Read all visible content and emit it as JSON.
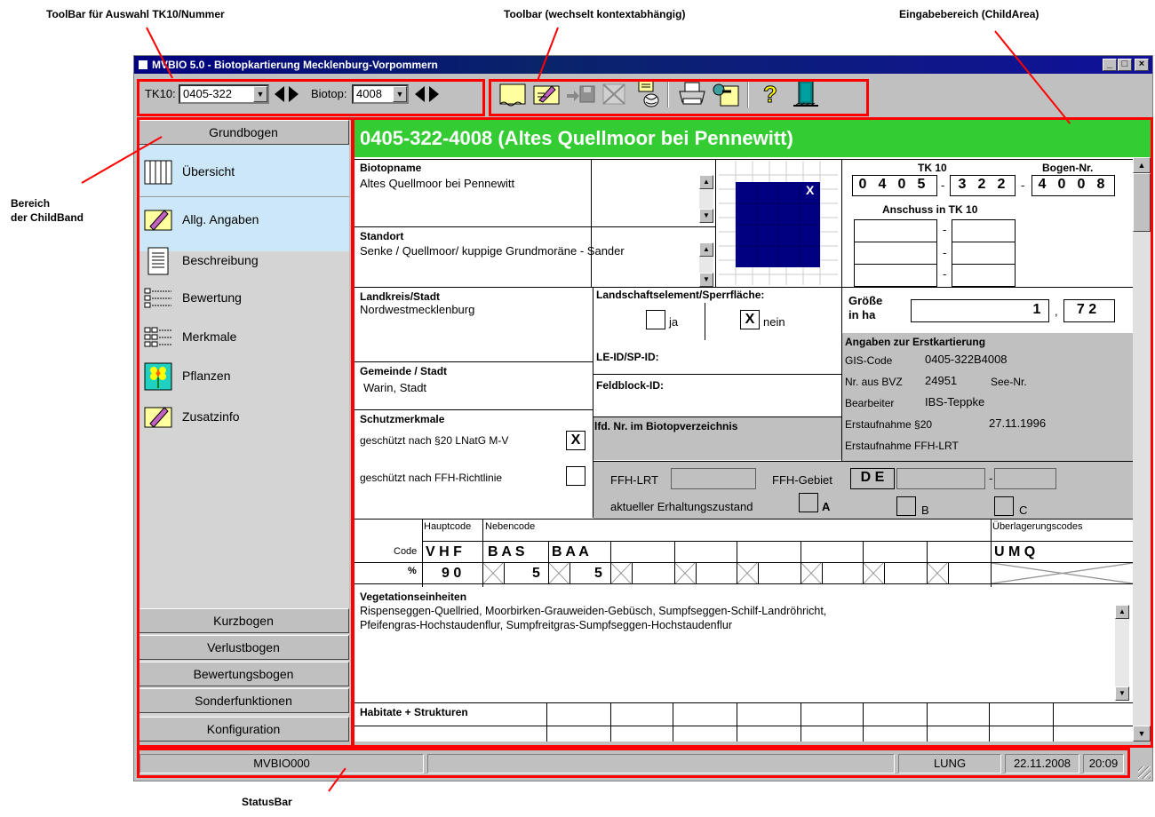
{
  "callouts": {
    "toolbar_tk10": "ToolBar für Auswahl TK10/Nummer",
    "toolbar_context": "Toolbar (wechselt kontextabhängig)",
    "childarea": "Eingabebereich (ChildArea)",
    "childband": "Bereich\nder ChildBand",
    "childband_line1": "Bereich",
    "childband_line2": "der ChildBand",
    "statusbar": "StatusBar"
  },
  "window": {
    "title": "MVBIO 5.0 - Biotopkartierung Mecklenburg-Vorpommern",
    "min": "_",
    "max": "□",
    "close": "×"
  },
  "toolbar": {
    "tk10_label": "TK10:",
    "tk10_value": "0405-322",
    "biotop_label": "Biotop:",
    "biotop_value": "4008",
    "buttons": [
      "new-icon",
      "edit-icon",
      "save-icon",
      "delete-icon",
      "export-icon",
      "print-icon",
      "search-icon",
      "help-icon",
      "exit-icon"
    ]
  },
  "sidebar": {
    "top_button": "Grundbogen",
    "items": [
      {
        "label": "Übersicht",
        "icon": "table-icon"
      },
      {
        "label": "Allg. Angaben",
        "icon": "edit-form-icon"
      },
      {
        "label": "Beschreibung",
        "icon": "notepad-icon"
      },
      {
        "label": "Bewertung",
        "icon": "checklist-icon"
      },
      {
        "label": "Merkmale",
        "icon": "grid-list-icon"
      },
      {
        "label": "Pflanzen",
        "icon": "flower-icon"
      },
      {
        "label": "Zusatzinfo",
        "icon": "edit-form-icon"
      }
    ],
    "bottom_buttons": [
      "Kurzbogen",
      "Verlustbogen",
      "Bewertungsbogen",
      "Sonderfunktionen",
      "Konfiguration"
    ]
  },
  "form": {
    "header": "0405-322-4008 (Altes Quellmoor bei Pennewitt)",
    "biotopname_label": "Biotopname",
    "biotopname_value": "Altes Quellmoor bei Pennewitt",
    "standort_label": "Standort",
    "standort_value": "Senke / Quellmoor/ kuppige Grundmoräne - Sander",
    "tk10_label": "TK 10",
    "tk10_digits": [
      "0",
      "4",
      "0",
      "5",
      "3",
      "2",
      "2"
    ],
    "bogen_label": "Bogen-Nr.",
    "bogen_digits": [
      "4",
      "0",
      "0",
      "8"
    ],
    "dash": "-",
    "anschuss_label": "Anschuss in TK 10",
    "map_mark": "X",
    "landkreis_label": "Landkreis/Stadt",
    "landkreis_value": "Nordwestmecklenburg",
    "landschaft_label": "Landschaftselement/Sperrfläche:",
    "ja_label": "ja",
    "nein_label": "nein",
    "nein_mark": "X",
    "groesse_label_1": "Größe",
    "groesse_label_2": "in ha",
    "groesse_int": "1",
    "groesse_comma": ",",
    "groesse_dec": "7 2",
    "leid_label": "LE-ID/SP-ID:",
    "gemeinde_label": "Gemeinde / Stadt",
    "gemeinde_value": "Warin, Stadt",
    "feldblock_label": "Feldblock-ID:",
    "lfd_label": "lfd. Nr. im Biotopverzeichnis",
    "erst_label": "Angaben zur Erstkartierung",
    "gis_label": "GIS-Code",
    "gis_value": "0405-322B4008",
    "bvz_label": "Nr. aus BVZ",
    "bvz_value": "24951",
    "see_label": "See-Nr.",
    "bearbeiter_label": "Bearbeiter",
    "bearbeiter_value": "IBS-Teppke",
    "erst20_label": "Erstaufnahme §20",
    "erst20_value": "27.11.1996",
    "erstffh_label": "Erstaufnahme FFH-LRT",
    "schutz_label": "Schutzmerkmale",
    "schutz20_label": "geschützt nach §20 LNatG M-V",
    "schutz20_mark": "X",
    "schutzffh_label": "geschützt nach FFH-Richtlinie",
    "ffhlrt_label": "FFH-LRT",
    "ffhgebiet_label": "FFH-Gebiet",
    "ffhgebiet_prefix": "D E",
    "erhaltung_label": "aktueller Erhaltungszustand",
    "erh_a": "A",
    "erh_b": "B",
    "erh_c": "C",
    "hauptcode_label": "Hauptcode",
    "nebencode_label": "Nebencode",
    "ueber_label": "Überlagerungscodes",
    "code_row_label": "Code",
    "pct_row_label": "%",
    "code_hf": "V H F",
    "code_n1": "B A S",
    "code_n2": "B A A",
    "code_ueber": "U M Q",
    "pct_haupt": "9 0",
    "pct_n1": "5",
    "pct_n2": "5",
    "veg_label": "Vegetationseinheiten",
    "veg_line1": "Rispenseggen-Quellried, Moorbirken-Grauweiden-Gebüsch, Sumpfseggen-Schilf-Landröhricht,",
    "veg_line2": "Pfeifengras-Hochstaudenflur, Sumpfreitgras-Sumpfseggen-Hochstaudenflur",
    "habitate_label": "Habitate + Strukturen"
  },
  "statusbar": {
    "p1": "MVBIO000",
    "p2": "",
    "p3": "LUNG",
    "date": "22.11.2008",
    "time": "20:09"
  },
  "colors": {
    "header_green": "#33cc33",
    "callout_red": "#ff0000",
    "titlebar_blue": "#000080",
    "map_blue": "#000080",
    "sidebar_highlight": "#cce8f8"
  }
}
